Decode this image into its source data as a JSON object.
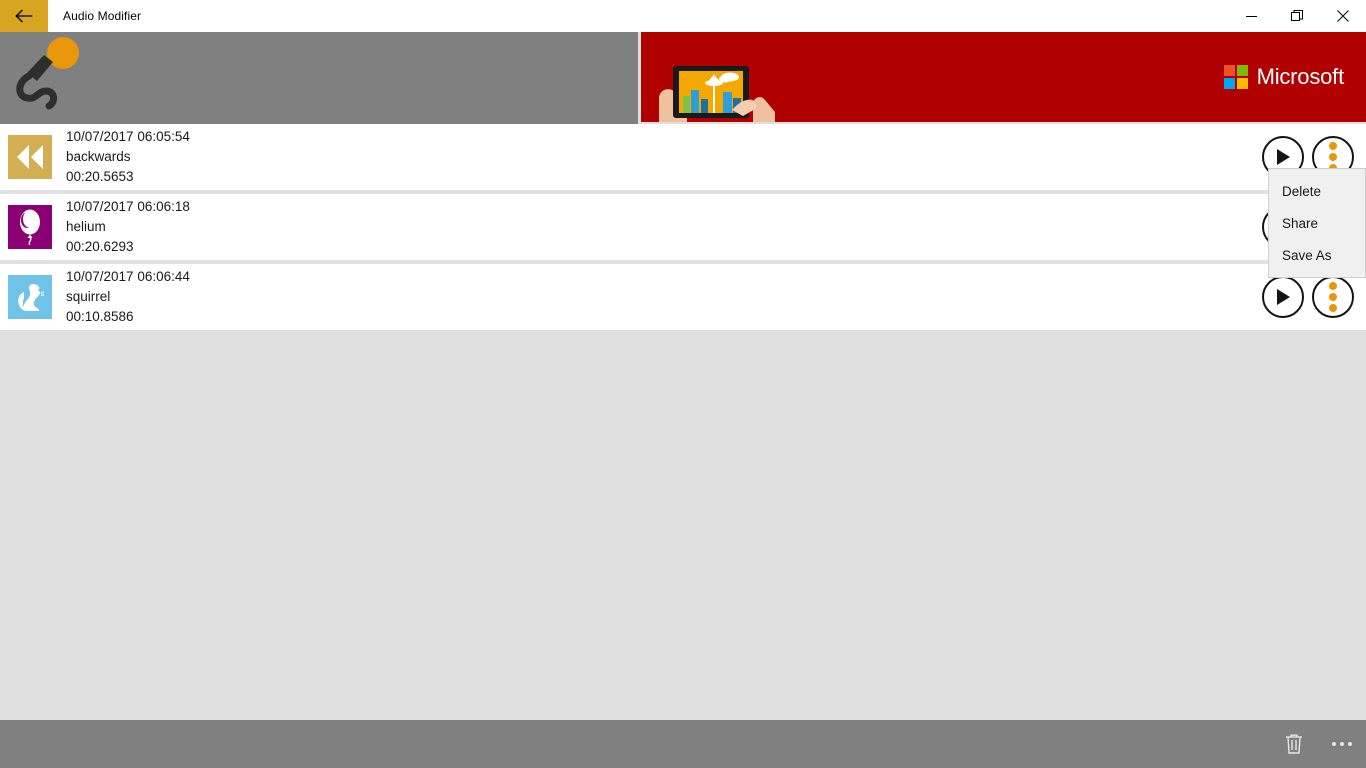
{
  "window": {
    "title": "Audio Modifier",
    "back_label": "Back",
    "minimize_label": "Minimize",
    "restore_label": "Restore",
    "close_label": "Close"
  },
  "header": {
    "logo_icon": "microphone-icon",
    "logo_accent_color": "#e8960a",
    "panel_color": "#808080"
  },
  "ad": {
    "brand": "Microsoft",
    "background_color": "#b00000",
    "art_icon": "hands-holding-tablet-seattle-skyline",
    "logo_colors": [
      "#f25022",
      "#7fba00",
      "#00a4ef",
      "#ffb900"
    ]
  },
  "recordings": [
    {
      "timestamp": "10/07/2017 06:05:54",
      "name": "backwards",
      "duration": "00:20.5653",
      "icon": "rewind-icon",
      "icon_bg": "#d4af51",
      "play_label": "Play",
      "more_label": "More options"
    },
    {
      "timestamp": "10/07/2017 06:06:18",
      "name": "helium",
      "duration": "00:20.6293",
      "icon": "balloon-icon",
      "icon_bg": "#8b0073",
      "play_label": "Play",
      "more_label": "More options"
    },
    {
      "timestamp": "10/07/2017 06:06:44",
      "name": "squirrel",
      "duration": "00:10.8586",
      "icon": "squirrel-icon",
      "icon_bg": "#6fc2e8",
      "play_label": "Play",
      "more_label": "More options"
    }
  ],
  "context_menu": {
    "items": [
      {
        "label": "Delete"
      },
      {
        "label": "Share"
      },
      {
        "label": "Save As"
      }
    ]
  },
  "appbar": {
    "delete_label": "Delete",
    "more_label": "See more"
  }
}
